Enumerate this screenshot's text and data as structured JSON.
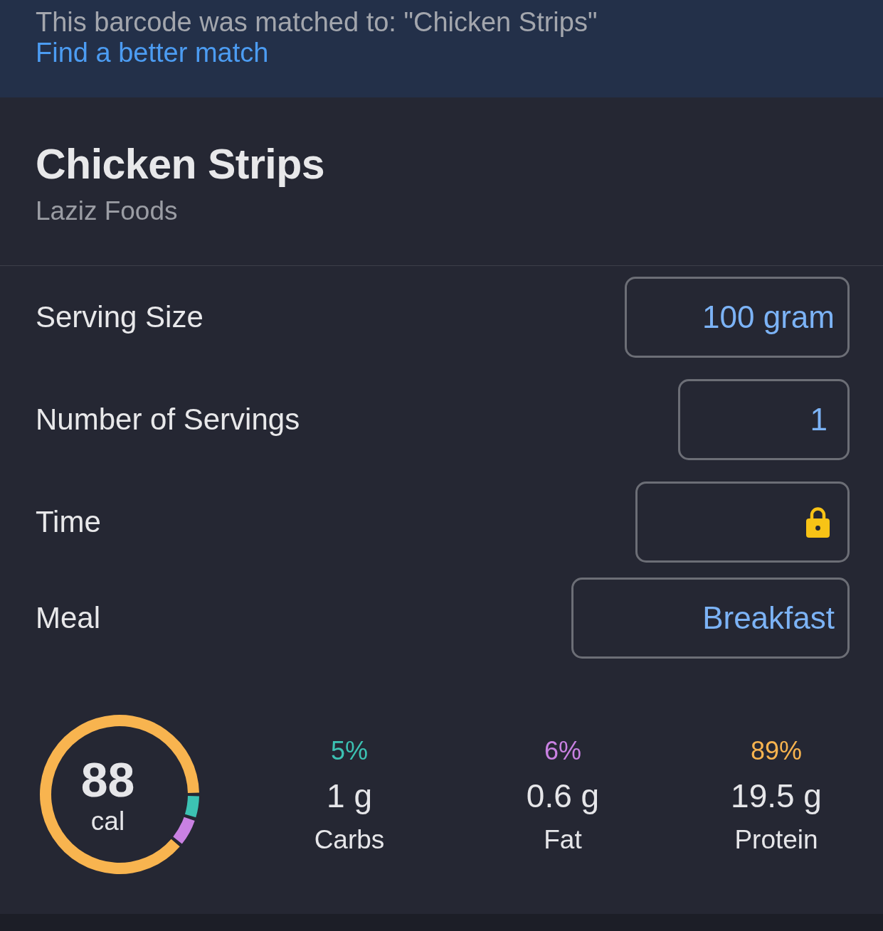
{
  "banner": {
    "message": "This barcode was matched to: \"Chicken Strips\"",
    "link": "Find a better match"
  },
  "food": {
    "name": "Chicken Strips",
    "brand": "Laziz Foods"
  },
  "fields": [
    {
      "label": "Serving Size",
      "kind": "picker",
      "value": "100 gram"
    },
    {
      "label": "Number of Servings",
      "kind": "number",
      "value": "1"
    },
    {
      "label": "Time",
      "kind": "time",
      "locked": true
    },
    {
      "label": "Meal",
      "kind": "picker",
      "value": "Breakfast"
    }
  ],
  "nutrition": {
    "calories": "88",
    "unit": "cal",
    "chart_data": {
      "type": "donut",
      "values": [
        5,
        6,
        89
      ]
    },
    "macros": [
      {
        "percent": "5%",
        "amount": "1 g",
        "name": "Carbs",
        "color": "#3cc2b3"
      },
      {
        "percent": "6%",
        "amount": "0.6 g",
        "name": "Fat",
        "color": "#c981e2"
      },
      {
        "percent": "89%",
        "amount": "19.5 g",
        "name": "Protein",
        "color": "#f8b44f"
      }
    ]
  }
}
